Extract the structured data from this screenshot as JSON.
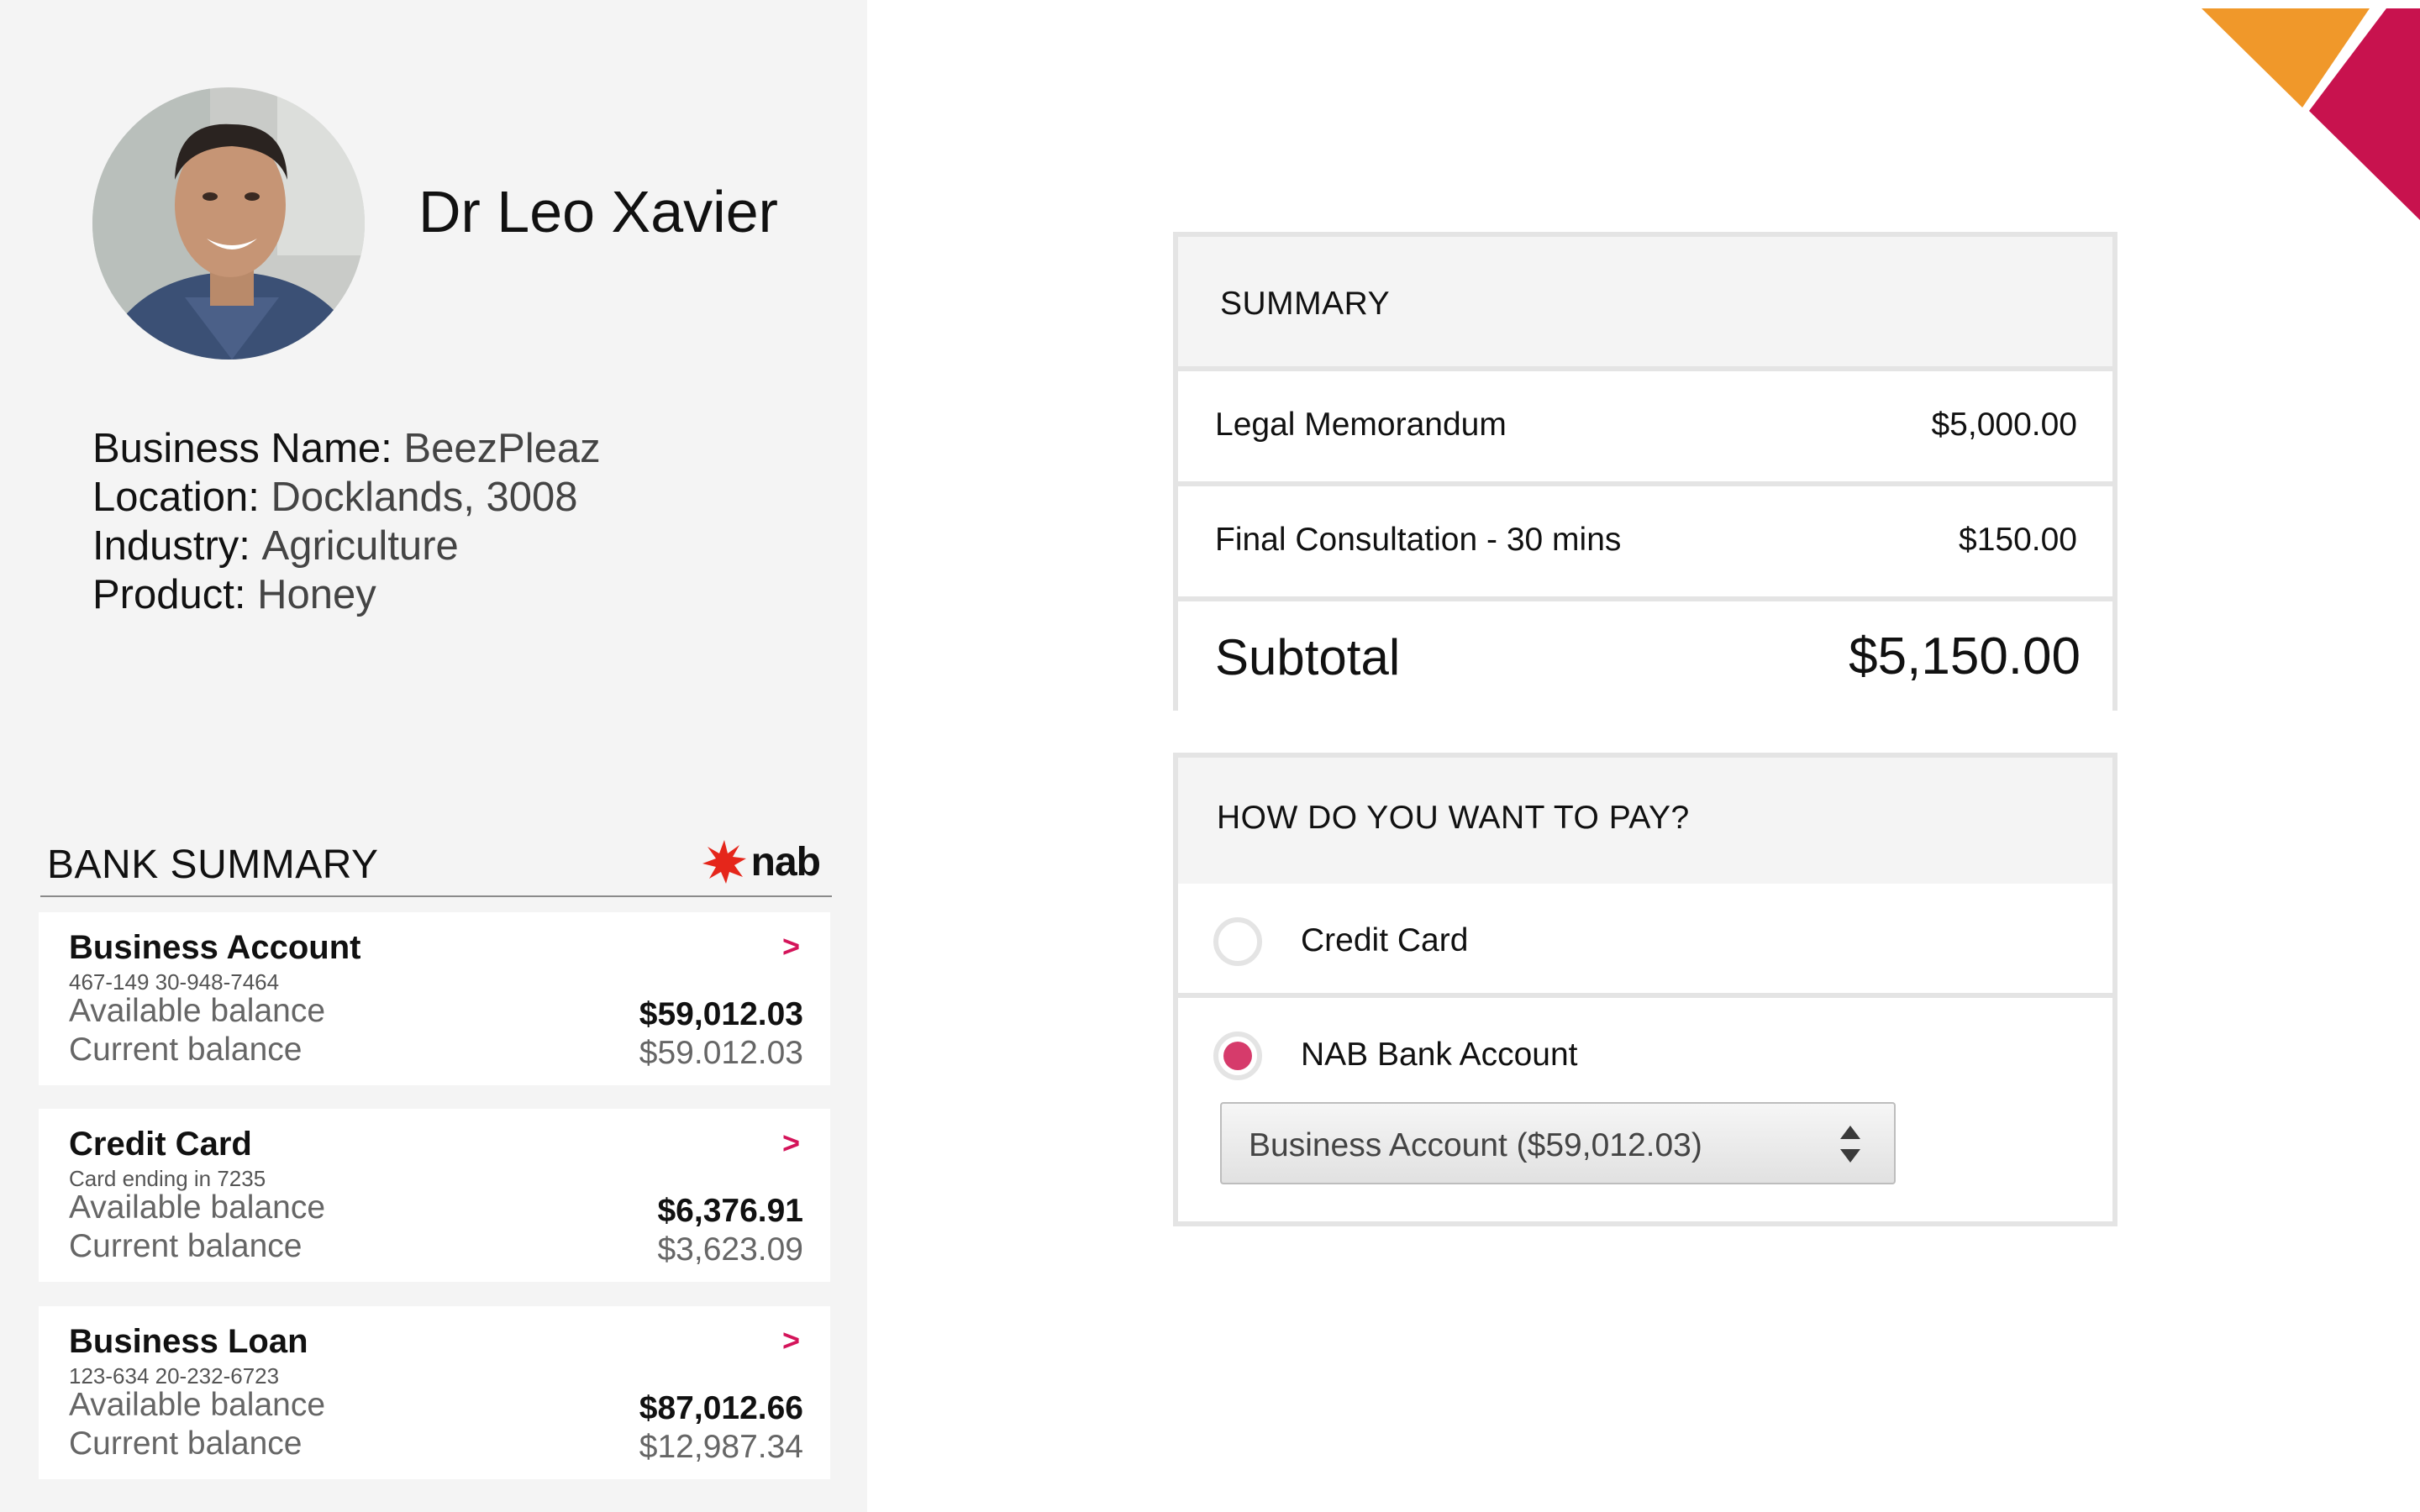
{
  "profile": {
    "name": "Dr Leo Xavier",
    "details": [
      {
        "label": "Business Name:",
        "value": "BeezPleaz"
      },
      {
        "label": "Location:",
        "value": "Docklands, 3008"
      },
      {
        "label": "Industry:",
        "value": "Agriculture"
      },
      {
        "label": "Product:",
        "value": "Honey"
      }
    ]
  },
  "bank_summary": {
    "title": "BANK SUMMARY",
    "logo_text": "nab",
    "accounts": [
      {
        "name": "Business Account",
        "number": "467-149 30-948-7464",
        "available_label": "Available balance",
        "available": "$59,012.03",
        "current_label": "Current balance",
        "current": "$59.012.03",
        "chevron": ">"
      },
      {
        "name": "Credit Card",
        "number": "Card ending in 7235",
        "available_label": "Available balance",
        "available": "$6,376.91",
        "current_label": "Current balance",
        "current": "$3,623.09",
        "chevron": ">"
      },
      {
        "name": "Business Loan",
        "number": "123-634 20-232-6723",
        "available_label": "Available balance",
        "available": "$87,012.66",
        "current_label": "Current balance",
        "current": "$12,987.34",
        "chevron": ">"
      }
    ]
  },
  "summary": {
    "title": "SUMMARY",
    "items": [
      {
        "label": "Legal Memorandum",
        "amount": "$5,000.00"
      },
      {
        "label": "Final Consultation - 30 mins",
        "amount": "$150.00"
      }
    ],
    "subtotal_label": "Subtotal",
    "subtotal_amount": "$5,150.00"
  },
  "payment": {
    "title": "HOW DO YOU WANT TO PAY?",
    "options": [
      {
        "label": "Credit Card",
        "selected": false
      },
      {
        "label": "NAB Bank Account",
        "selected": true
      }
    ],
    "account_select_value": "Business Account ($59,012.03)"
  },
  "colors": {
    "accent_pink": "#d4145a",
    "radio_selected": "#d63b6b",
    "decor_orange": "#f0982a",
    "decor_crimson": "#c8124e",
    "panel_bg": "#f4f4f4",
    "border": "#e4e4e4"
  },
  "icons": {
    "nab_star": "nab-star-icon",
    "select_arrows": "up-down-arrows-icon"
  }
}
